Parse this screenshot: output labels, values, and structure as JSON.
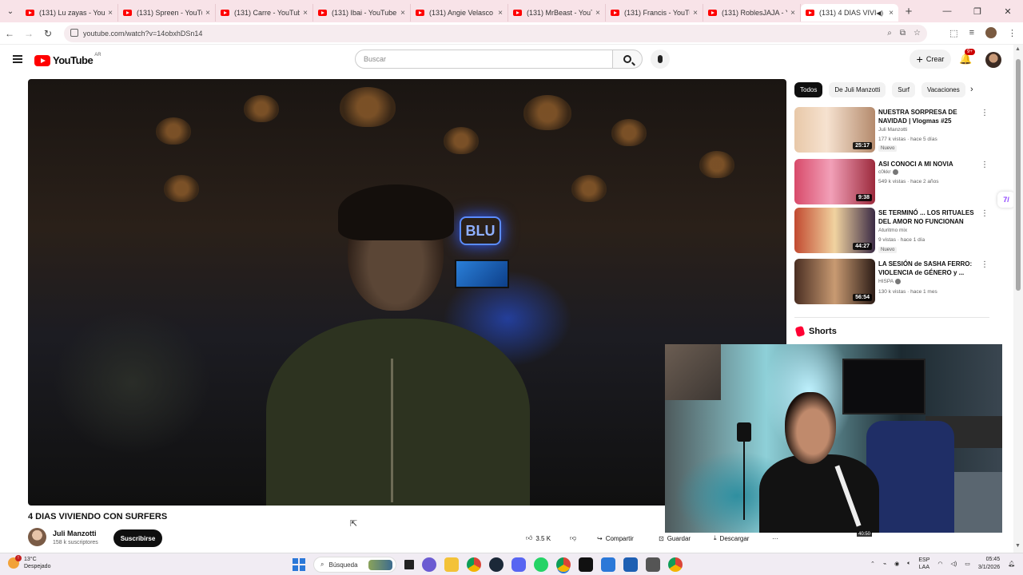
{
  "browser": {
    "tabs": [
      {
        "label": "(131) Lu zayas - YouT"
      },
      {
        "label": "(131) Spreen - YouTub"
      },
      {
        "label": "(131) Carre - YouTube"
      },
      {
        "label": "(131) Ibai - YouTube"
      },
      {
        "label": "(131) Angie Velasco -"
      },
      {
        "label": "(131) MrBeast - YouT"
      },
      {
        "label": "(131) Francis - YouTu"
      },
      {
        "label": "(131) RoblesJAJA - Y"
      },
      {
        "label": "(131) 4 DIAS VIVI"
      }
    ],
    "url": "youtube.com/watch?v=14obxhDSn14"
  },
  "youtube": {
    "logo_text": "YouTube",
    "country_code": "AR",
    "search_placeholder": "Buscar",
    "create_label": "Crear",
    "notifications_count": "9+"
  },
  "video": {
    "neon_sign": "BLU",
    "title": "4 DIAS VIVIENDO CON SURFERS",
    "channel": "Juli Manzotti",
    "subscribers": "158 k suscriptores",
    "subscribe_label": "Suscribirse",
    "likes": "3.5 K",
    "share_label": "Compartir",
    "save_label": "Guardar",
    "download_label": "Descargar",
    "more_label": "···"
  },
  "sidebar": {
    "chips": [
      "Todos",
      "De Juli Manzotti",
      "Surf",
      "Vacaciones"
    ],
    "recommendations": [
      {
        "title": "NUESTRA SORPRESA DE NAVIDAD | Vlogmas #25",
        "channel": "Juli Manzotti",
        "meta": "177 k vistas · hace 5 días",
        "badge": "Nuevo",
        "duration": "25:17"
      },
      {
        "title": "ASI CONOCI A MI NOVIA",
        "channel": "c0kkr",
        "meta": "549 k vistas · hace 2 años",
        "badge": "",
        "duration": "9:38"
      },
      {
        "title": "SE TERMINÓ ... LOS RITUALES DEL AMOR NO FUNCIONAN",
        "channel": "Aturitmo mix",
        "meta": "9 vistas · hace 1 día",
        "badge": "Nuevo",
        "duration": "44:27"
      },
      {
        "title": "LA SESIÓN de SASHA FERRO: VIOLENCIA de GÉNERO y ...",
        "channel": "HISPA",
        "meta": "130 k vistas · hace 1 mes",
        "badge": "",
        "duration": "56:54"
      }
    ],
    "shorts_label": "Shorts",
    "short_duration": "40:50"
  },
  "taskbar": {
    "temperature": "13°C",
    "weather": "Despejado",
    "search_label": "Búsqueda",
    "lang_line1": "ESP",
    "lang_line2": "LAA",
    "time": "05:45",
    "date": "3/1/2026"
  }
}
